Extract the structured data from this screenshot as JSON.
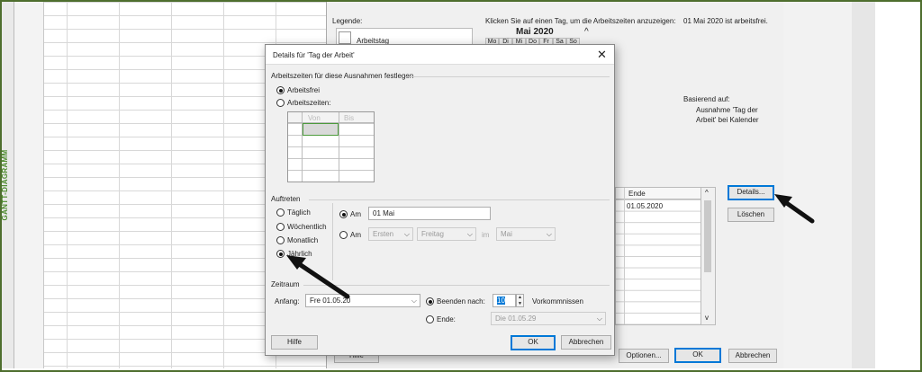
{
  "sheet": {
    "side_label": "GANTT-DIAGRAMM"
  },
  "back_dialog": {
    "legend_label": "Legende:",
    "legend_item_1": "Arbeitstag",
    "instruction": "Klicken Sie auf einen Tag, um die Arbeitszeiten anzuzeigen:",
    "date_status": "01 Mai 2020 ist arbeitsfrei.",
    "calendar_month": "Mai 2020",
    "calendar_weekdays": [
      "Mo",
      "Di",
      "Mi",
      "Do",
      "Fr",
      "Sa",
      "So"
    ],
    "based_on_label": "Basierend auf:",
    "based_on_text_1": "Ausnahme 'Tag der",
    "based_on_text_2": "Arbeit' bei Kalender",
    "table_header_end": "Ende",
    "table_row_1_end": "01.05.2020",
    "details_button": "Details...",
    "delete_button": "Löschen",
    "help_button": "Hilfe",
    "options_button": "Optionen...",
    "ok_button": "OK",
    "cancel_button": "Abbrechen"
  },
  "dialog": {
    "title": "Details für 'Tag der Arbeit'",
    "close_icon": "close-icon",
    "section_worktimes": "Arbeitszeiten für diese Ausnahmen festlegen",
    "radio_off": "Arbeitsfrei",
    "radio_worktimes": "Arbeitszeiten:",
    "col_from": "Von",
    "col_to": "Bis",
    "section_recurrence": "Auftreten",
    "rec_daily": "Täglich",
    "rec_weekly": "Wöchentlich",
    "rec_monthly": "Monatlich",
    "rec_yearly": "Jährlich",
    "am_label": "Am",
    "am_value": "01 Mai",
    "am2_label": "Am",
    "am2_ordinal": "Ersten",
    "am2_weekday": "Freitag",
    "im_label": "im",
    "am2_month": "Mai",
    "section_range": "Zeitraum",
    "start_label": "Anfang:",
    "start_value": "Fre 01.05.20",
    "end_after_label": "Beenden nach:",
    "end_after_value": "10",
    "occurrences_label": "Vorkommnissen",
    "end_label": "Ende:",
    "end_value": "Die 01.05.29",
    "help_button": "Hilfe",
    "ok_button": "OK",
    "cancel_button": "Abbrechen"
  },
  "colors": {
    "accent": "#0078d7",
    "frame": "#4e6e2e",
    "side_label": "#4b8a2a"
  }
}
